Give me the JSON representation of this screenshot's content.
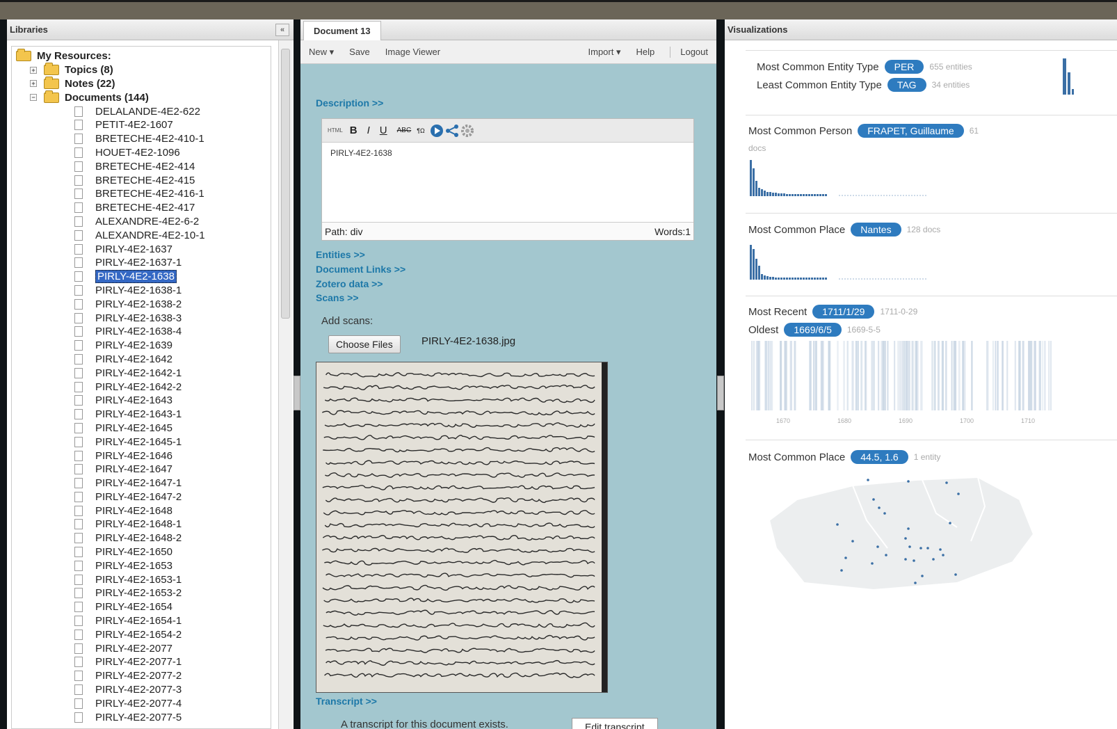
{
  "libraries": {
    "title": "Libraries",
    "collapse": "«",
    "tree": {
      "root": "My Resources:",
      "topics": "Topics (8)",
      "notes": "Notes (22)",
      "documents": "Documents (144)",
      "items": [
        "DELALANDE-4E2-622",
        "PETIT-4E2-1607",
        "BRETECHE-4E2-410-1",
        "HOUET-4E2-1096",
        "BRETECHE-4E2-414",
        "BRETECHE-4E2-415",
        "BRETECHE-4E2-416-1",
        "BRETECHE-4E2-417",
        "ALEXANDRE-4E2-6-2",
        "ALEXANDRE-4E2-10-1",
        "PIRLY-4E2-1637",
        "PIRLY-4E2-1637-1",
        "PIRLY-4E2-1638",
        "PIRLY-4E2-1638-1",
        "PIRLY-4E2-1638-2",
        "PIRLY-4E2-1638-3",
        "PIRLY-4E2-1638-4",
        "PIRLY-4E2-1639",
        "PIRLY-4E2-1642",
        "PIRLY-4E2-1642-1",
        "PIRLY-4E2-1642-2",
        "PIRLY-4E2-1643",
        "PIRLY-4E2-1643-1",
        "PIRLY-4E2-1645",
        "PIRLY-4E2-1645-1",
        "PIRLY-4E2-1646",
        "PIRLY-4E2-1647",
        "PIRLY-4E2-1647-1",
        "PIRLY-4E2-1647-2",
        "PIRLY-4E2-1648",
        "PIRLY-4E2-1648-1",
        "PIRLY-4E2-1648-2",
        "PIRLY-4E2-1650",
        "PIRLY-4E2-1653",
        "PIRLY-4E2-1653-1",
        "PIRLY-4E2-1653-2",
        "PIRLY-4E2-1654",
        "PIRLY-4E2-1654-1",
        "PIRLY-4E2-1654-2",
        "PIRLY-4E2-2077",
        "PIRLY-4E2-2077-1",
        "PIRLY-4E2-2077-2",
        "PIRLY-4E2-2077-3",
        "PIRLY-4E2-2077-4",
        "PIRLY-4E2-2077-5"
      ],
      "selected_index": 12
    }
  },
  "document": {
    "tab": "Document 13",
    "toolbar": {
      "new": "New ▾",
      "save": "Save",
      "image_viewer": "Image Viewer",
      "import": "Import ▾",
      "help": "Help",
      "logout": "Logout"
    },
    "description": "Description >>",
    "editor": {
      "html_btn": "HTML",
      "bold": "B",
      "italic": "I",
      "underline": "U",
      "content": "PIRLY-4E2-1638",
      "path": "Path: div",
      "words": "Words:1"
    },
    "entities": "Entities >>",
    "document_links": "Document Links >>",
    "zotero": "Zotero data >>",
    "scans": "Scans >>",
    "add_scans": "Add scans:",
    "choose_files": "Choose Files",
    "file_name": "PIRLY-4E2-1638.jpg",
    "transcript": "Transcript >>",
    "transcript_note": "A transcript for this document exists.",
    "edit_transcript": "Edit transcript"
  },
  "visualizations": {
    "title": "Visualizations",
    "entity_type": {
      "most_label": "Most Common Entity Type",
      "most_value": "PER",
      "most_count": "655 entities",
      "least_label": "Least Common Entity Type",
      "least_value": "TAG",
      "least_count": "34 entities"
    },
    "person": {
      "label": "Most Common Person",
      "value": "FRAPET, Guillaume",
      "count": "61",
      "unit": "docs"
    },
    "place": {
      "label": "Most Common Place",
      "value": "Nantes",
      "count": "128 docs"
    },
    "dates": {
      "recent_label": "Most Recent",
      "recent_value": "1711/1/29",
      "recent_raw": "1711-0-29",
      "oldest_label": "Oldest",
      "oldest_value": "1669/6/5",
      "oldest_raw": "1669-5-5",
      "axis_ticks": [
        "1670",
        "1680",
        "1690",
        "1700",
        "1710"
      ]
    },
    "geo": {
      "label": "Most Common Place",
      "value": "44.5, 1.6",
      "count": "1 entity"
    },
    "accent": "#2e7bbf"
  }
}
